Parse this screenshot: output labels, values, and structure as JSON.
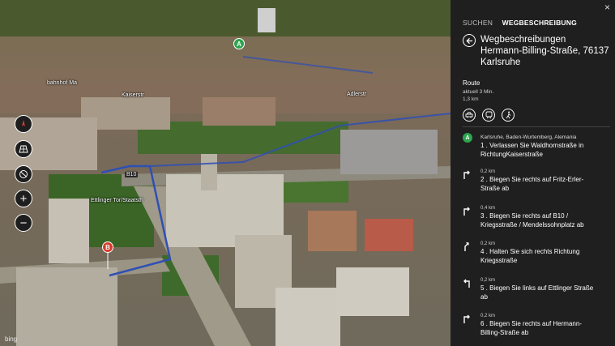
{
  "map": {
    "street_labels": [
      "B10",
      "Adlerstr",
      "Ettlinger Tor/Staatsth",
      "bahnhof Ma",
      "Kaiserstr"
    ],
    "markers": {
      "start": "A",
      "end": "B"
    },
    "controls": {
      "zoom_in": "+",
      "zoom_out": "−"
    },
    "brand": "bing",
    "colors": {
      "route": "#2f4fb5",
      "start_marker": "#2ea44f",
      "end_marker": "#d83b2b"
    }
  },
  "panel": {
    "close_label": "×",
    "tabs": {
      "search": "SUCHEN",
      "directions": "WEGBESCHREIBUNG"
    },
    "title_line1": "Wegbeschreibungen",
    "title_line2": "Hermann-Billing-Straße, 76137",
    "title_line3": "Karlsruhe",
    "route_label": "Route",
    "route_time": "aktuell 3 Min.",
    "route_distance": "1,3 km",
    "start_location": "Karlsruhe, Baden-Wurtemberg, Alemania",
    "steps": [
      {
        "text1": "1 .  Verlassen Sie Waldhornstraße in",
        "text2": "RichtungKaiserstraße"
      },
      {
        "dist": "0,2 km",
        "text1": "2 .  Biegen Sie rechts auf Fritz-Erler-",
        "text2": "Straße ab"
      },
      {
        "dist": "0,4 km",
        "text1": "3 .  Biegen Sie rechts auf B10 /",
        "text2": "Kriegsstraße / Mendelssohnplatz ab"
      },
      {
        "dist": "0,2 km",
        "text1": "4 .  Halten Sie sich rechts Richtung",
        "text2": "Kriegsstraße"
      },
      {
        "dist": "0,2 km",
        "text1": "5 .  Biegen Sie links auf Ettlinger Straße",
        "text2": "ab"
      },
      {
        "dist": "0,2 km",
        "text1": "6 .  Biegen Sie rechts auf Hermann-",
        "text2": "Billing-Straße ab"
      }
    ]
  }
}
